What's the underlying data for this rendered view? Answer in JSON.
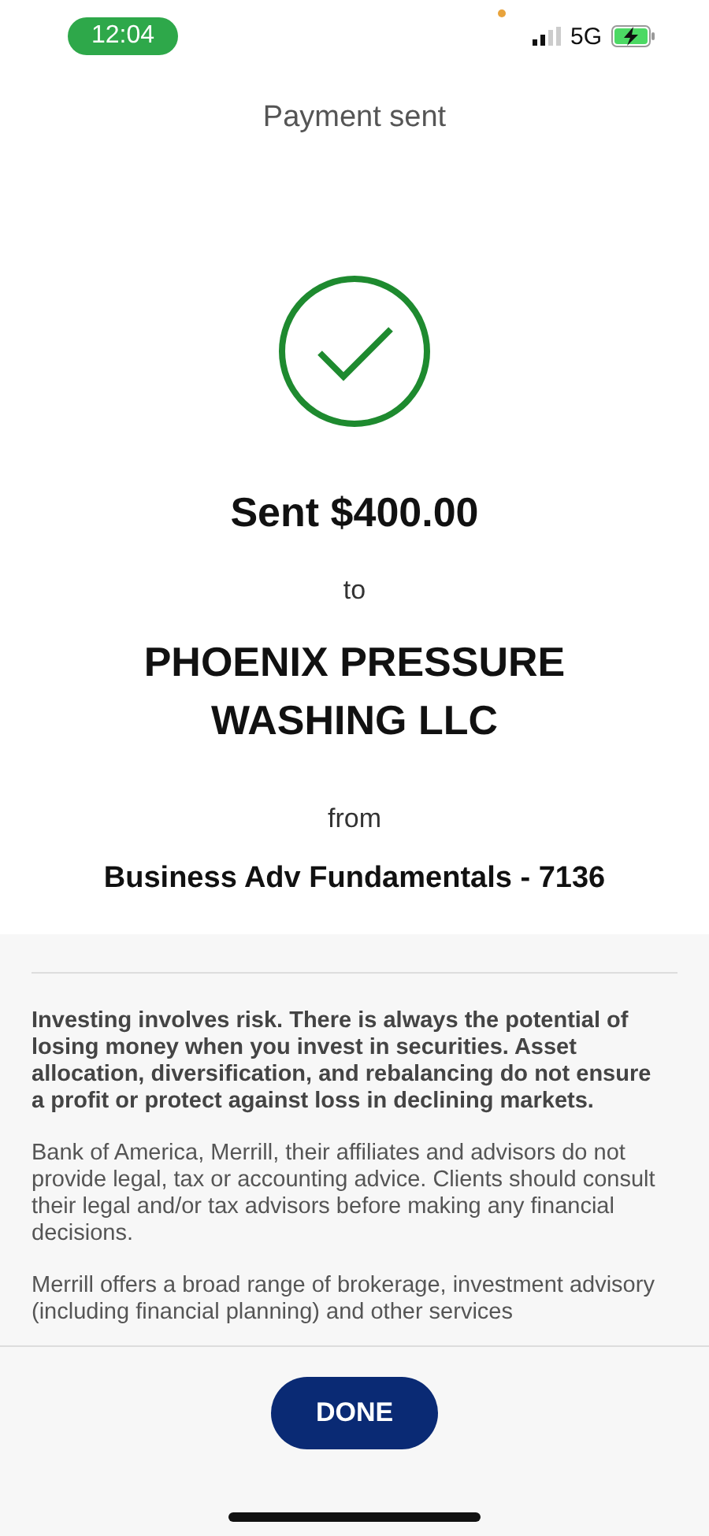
{
  "status_bar": {
    "time": "12:04",
    "network": "5G"
  },
  "header": {
    "title": "Payment sent"
  },
  "confirmation": {
    "amount_line": "Sent $400.00",
    "to_label": "to",
    "payee": "PHOENIX PRESSURE WASHING LLC",
    "from_label": "from",
    "account": "Business Adv Fundamentals - 7136"
  },
  "disclosures": [
    {
      "text": "Investing involves risk. There is always the potential of losing money when you invest in securities. Asset allocation, diversification, and rebalancing do not ensure a profit or protect against loss in declining markets.",
      "strong": true
    },
    {
      "text": "Bank of America, Merrill, their affiliates and advisors do not provide legal, tax or accounting advice. Clients should consult their legal and/or tax advisors before making any financial decisions.",
      "strong": false
    },
    {
      "text": "Merrill offers a broad range of brokerage, investment advisory (including financial planning) and other services",
      "strong": false
    }
  ],
  "footer": {
    "button": "DONE"
  }
}
